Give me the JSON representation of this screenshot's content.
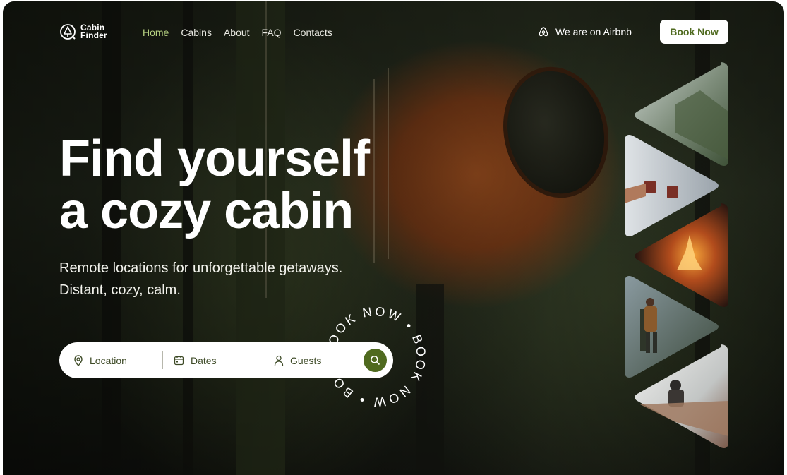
{
  "header": {
    "logo_line1": "Cabin",
    "logo_line2": "Finder",
    "nav": [
      "Home",
      "Cabins",
      "About",
      "FAQ",
      "Contacts"
    ],
    "active_nav": "Home",
    "airbnb_text": "We are on Airbnb",
    "book_label": "Book Now"
  },
  "hero": {
    "title_line1": "Find yourself",
    "title_line2": "a cozy cabin",
    "subtitle_line1": "Remote locations for unforgettable getaways.",
    "subtitle_line2": "Distant, cozy, calm."
  },
  "search": {
    "location": "Location",
    "dates": "Dates",
    "guests": "Guests"
  },
  "badge_text": "BOOK NOW • BOOK NOW • BOOK NOW •",
  "gallery": [
    "misty-valley",
    "coffee-cups-snow",
    "campfire",
    "forest-hiker",
    "snowy-cabin-window"
  ],
  "colors": {
    "accent": "#4f6a1f",
    "nav_active": "#b6d181"
  }
}
